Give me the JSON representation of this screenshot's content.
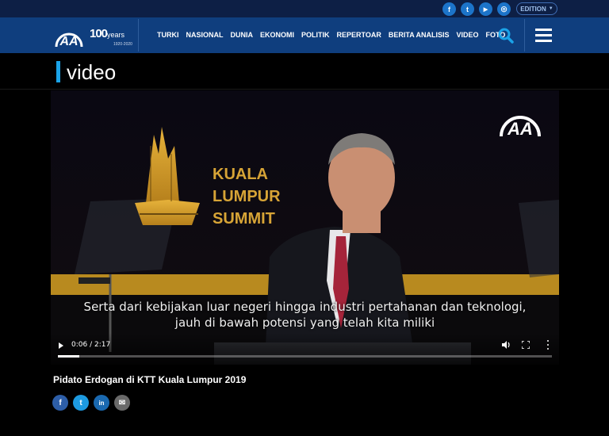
{
  "header": {
    "social_top": [
      {
        "name": "facebook",
        "glyph": "f",
        "color": "#1c74c9"
      },
      {
        "name": "twitter",
        "glyph": "t",
        "color": "#1c74c9"
      },
      {
        "name": "youtube",
        "glyph": "▶",
        "color": "#1c74c9"
      },
      {
        "name": "instagram",
        "glyph": "◎",
        "color": "#1c74c9"
      }
    ],
    "edition_label": "EDITION",
    "years_main": "100",
    "years_suffix": "years",
    "years_range": "1920-2020",
    "nav_items": [
      "TURKI",
      "NASIONAL",
      "DUNIA",
      "EKONOMI",
      "POLITIK",
      "REPERTOAR",
      "BERITA ANALISIS",
      "VIDEO",
      "FOTO"
    ]
  },
  "section": {
    "title": "video",
    "accent_color": "#1aa3e8"
  },
  "video": {
    "logo_text": "AA",
    "banner_lines": [
      "KUALA",
      "LUMPUR",
      "SUMMIT"
    ],
    "subtitle_lines": [
      "Serta dari kebijakan luar negeri hingga industri pertahanan dan teknologi,",
      "jauh di bawah potensi yang telah kita miliki"
    ],
    "time_display": "0:06 / 2:17",
    "progress_fraction": 0.044
  },
  "caption": "Pidato Erdogan di KTT Kuala Lumpur 2019",
  "share": [
    {
      "name": "facebook",
      "glyph": "f",
      "color": "#2d5ea8"
    },
    {
      "name": "twitter",
      "glyph": "t",
      "color": "#1d9ae0"
    },
    {
      "name": "linkedin",
      "glyph": "in",
      "color": "#1a69b0"
    },
    {
      "name": "email",
      "glyph": "✉",
      "color": "#6a6a6a"
    }
  ]
}
